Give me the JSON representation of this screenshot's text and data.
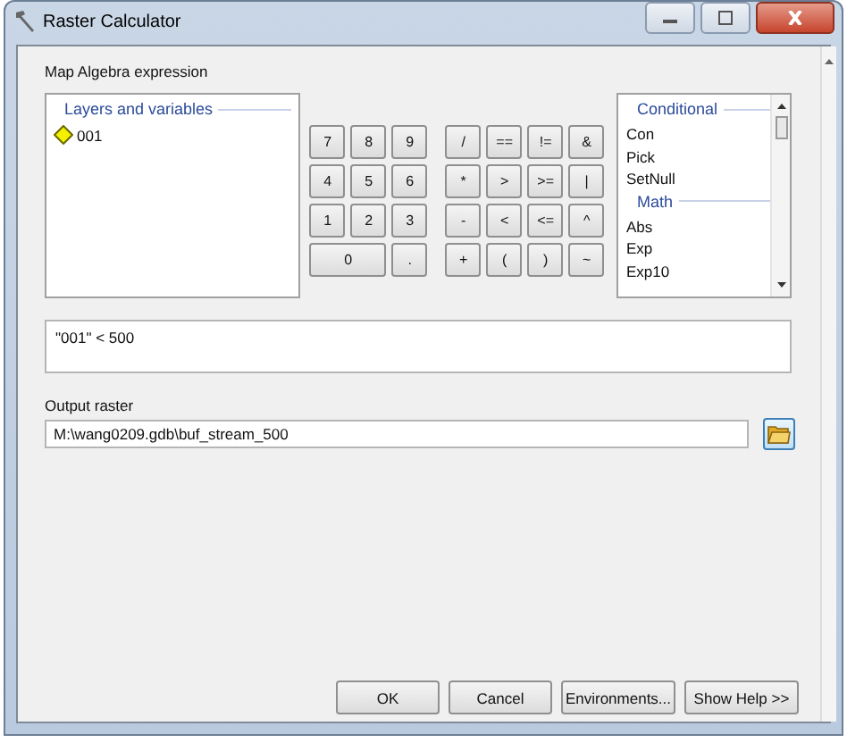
{
  "window": {
    "title": "Raster Calculator"
  },
  "expression_label": "Map Algebra expression",
  "layers": {
    "heading": "Layers and variables",
    "items": [
      {
        "name": "001",
        "selected": false
      }
    ]
  },
  "keypad": [
    [
      {
        "label": "7",
        "kind": "normal"
      },
      {
        "label": "8",
        "kind": "normal"
      },
      {
        "label": "9",
        "kind": "normal"
      },
      {
        "label": "/",
        "kind": "op"
      },
      {
        "label": "==",
        "kind": "op"
      },
      {
        "label": "!=",
        "kind": "op"
      },
      {
        "label": "&",
        "kind": "op"
      }
    ],
    [
      {
        "label": "4",
        "kind": "normal"
      },
      {
        "label": "5",
        "kind": "normal"
      },
      {
        "label": "6",
        "kind": "normal"
      },
      {
        "label": "*",
        "kind": "op"
      },
      {
        "label": ">",
        "kind": "op"
      },
      {
        "label": ">=",
        "kind": "op"
      },
      {
        "label": "|",
        "kind": "op"
      }
    ],
    [
      {
        "label": "1",
        "kind": "normal"
      },
      {
        "label": "2",
        "kind": "normal"
      },
      {
        "label": "3",
        "kind": "normal"
      },
      {
        "label": "-",
        "kind": "op"
      },
      {
        "label": "<",
        "kind": "op"
      },
      {
        "label": "<=",
        "kind": "op"
      },
      {
        "label": "^",
        "kind": "op"
      }
    ],
    [
      {
        "label": "0",
        "kind": "wide"
      },
      {
        "label": ".",
        "kind": "normal"
      },
      {
        "label": "+",
        "kind": "op"
      },
      {
        "label": "(",
        "kind": "op"
      },
      {
        "label": ")",
        "kind": "op"
      },
      {
        "label": "~",
        "kind": "op"
      }
    ]
  ],
  "functions": [
    {
      "kind": "heading",
      "label": "Conditional"
    },
    {
      "kind": "item",
      "label": "Con"
    },
    {
      "kind": "item",
      "label": "Pick"
    },
    {
      "kind": "item",
      "label": "SetNull"
    },
    {
      "kind": "heading",
      "label": "Math"
    },
    {
      "kind": "item",
      "label": "Abs"
    },
    {
      "kind": "item",
      "label": "Exp"
    },
    {
      "kind": "item",
      "label": "Exp10"
    }
  ],
  "expression": "\"001\" < 500",
  "output": {
    "label": "Output raster",
    "value": "M:\\wang0209.gdb\\buf_stream_500"
  },
  "buttons": [
    "OK",
    "Cancel",
    "Environments...",
    "Show Help >>"
  ]
}
